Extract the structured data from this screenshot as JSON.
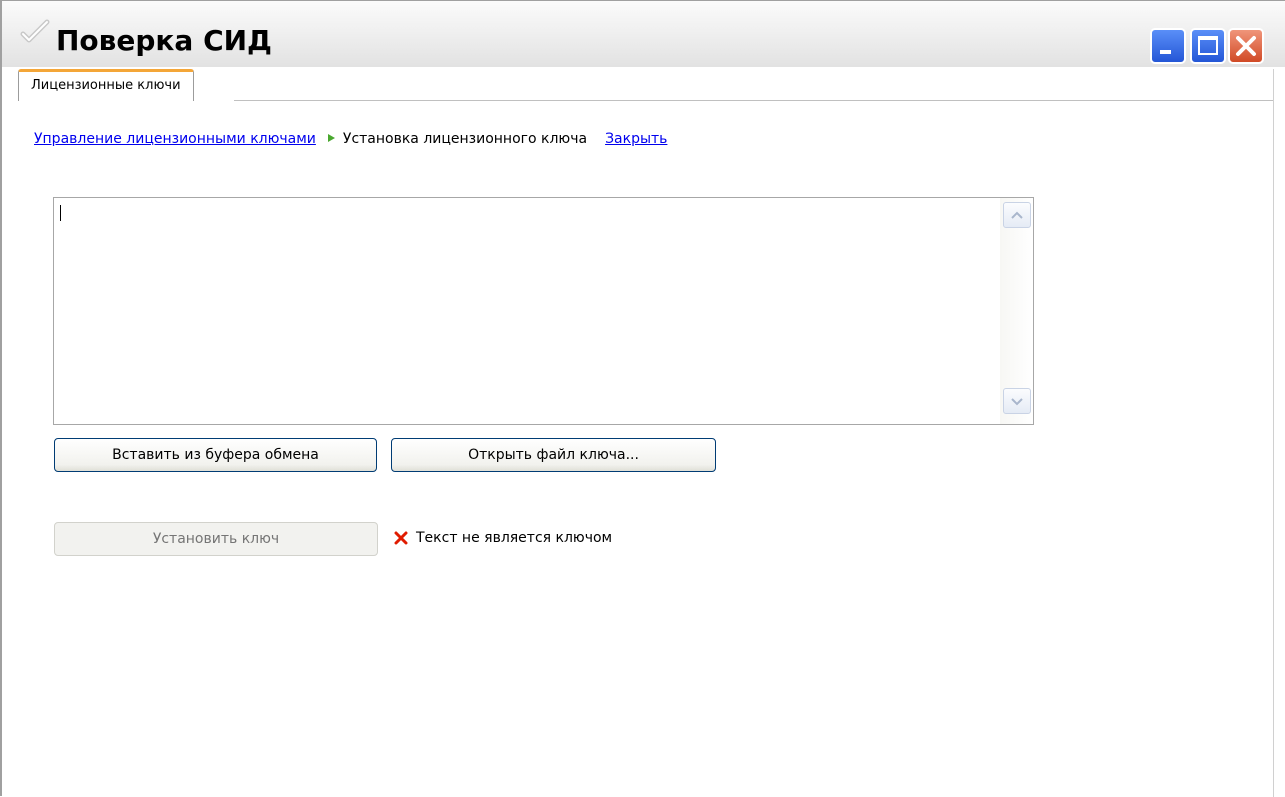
{
  "window": {
    "title": "Поверка СИД",
    "icon": "app-icon",
    "controls": [
      "minimize-icon",
      "maximize-icon",
      "close-icon"
    ]
  },
  "tabs": [
    {
      "label": "Лицензионные ключи",
      "active": true
    }
  ],
  "breadcrumb": {
    "parent_link": "Управление лицензионными ключами",
    "current": "Установка лицензионного ключа",
    "close_link": "Закрыть"
  },
  "key_input": {
    "value": ""
  },
  "buttons": {
    "paste": "Вставить из буфера обмена",
    "open_file": "Открыть файл ключа...",
    "install": "Установить ключ"
  },
  "status": {
    "text": "Текст не является ключом",
    "icon": "error-x-icon",
    "icon_color": "#e01b00"
  },
  "colors": {
    "tab_accent": "#f4a638",
    "link": "#0000ee",
    "breadcrumb_arrow": "#4aa82f",
    "button_border": "#003c74"
  }
}
